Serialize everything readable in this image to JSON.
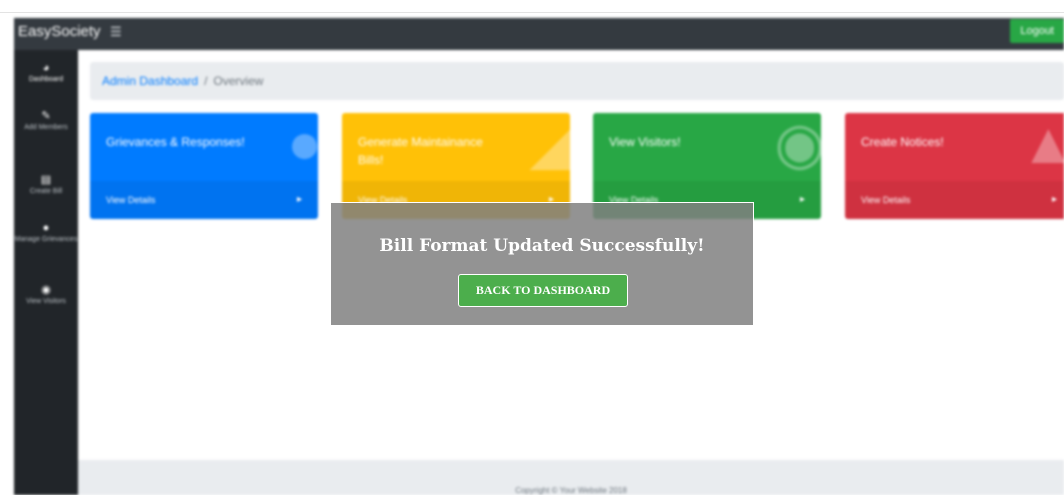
{
  "navbar": {
    "brand": "EasySociety",
    "menu_icon": "hamburger-menu-icon",
    "logout_label": "Logout"
  },
  "sidebar": {
    "items": [
      {
        "label": "Dashboard",
        "icon": "dashboard-gauge-icon",
        "active": true
      },
      {
        "label": "Add Members",
        "icon": "pencil-icon"
      },
      {
        "label": "Create Bill",
        "icon": "bill-icon"
      },
      {
        "label": "Manage Grievances",
        "icon": "comments-icon"
      },
      {
        "label": "View Visitors",
        "icon": "eye-icon"
      }
    ]
  },
  "breadcrumb": {
    "link": "Admin Dashboard",
    "separator": "/",
    "current": "Overview"
  },
  "cards": [
    {
      "title": "Grievances & Responses!",
      "footer": "View Details",
      "icon": "comments-icon",
      "color": "#007bff"
    },
    {
      "title": "Generate Maintainance Bills!",
      "footer": "View Details",
      "icon": "area-chart-icon",
      "color": "#ffc107"
    },
    {
      "title": "View Visitors!",
      "footer": "View Details",
      "icon": "eye-icon",
      "color": "#28a745"
    },
    {
      "title": "Create Notices!",
      "footer": "View Details",
      "icon": "bullhorn-icon",
      "color": "#dc3545"
    }
  ],
  "footer": {
    "copyright": "Copyright © Your Website 2018"
  },
  "modal": {
    "message": "Bill Format Updated Successfully!",
    "button_label": "BACK TO DASHBOARD"
  }
}
